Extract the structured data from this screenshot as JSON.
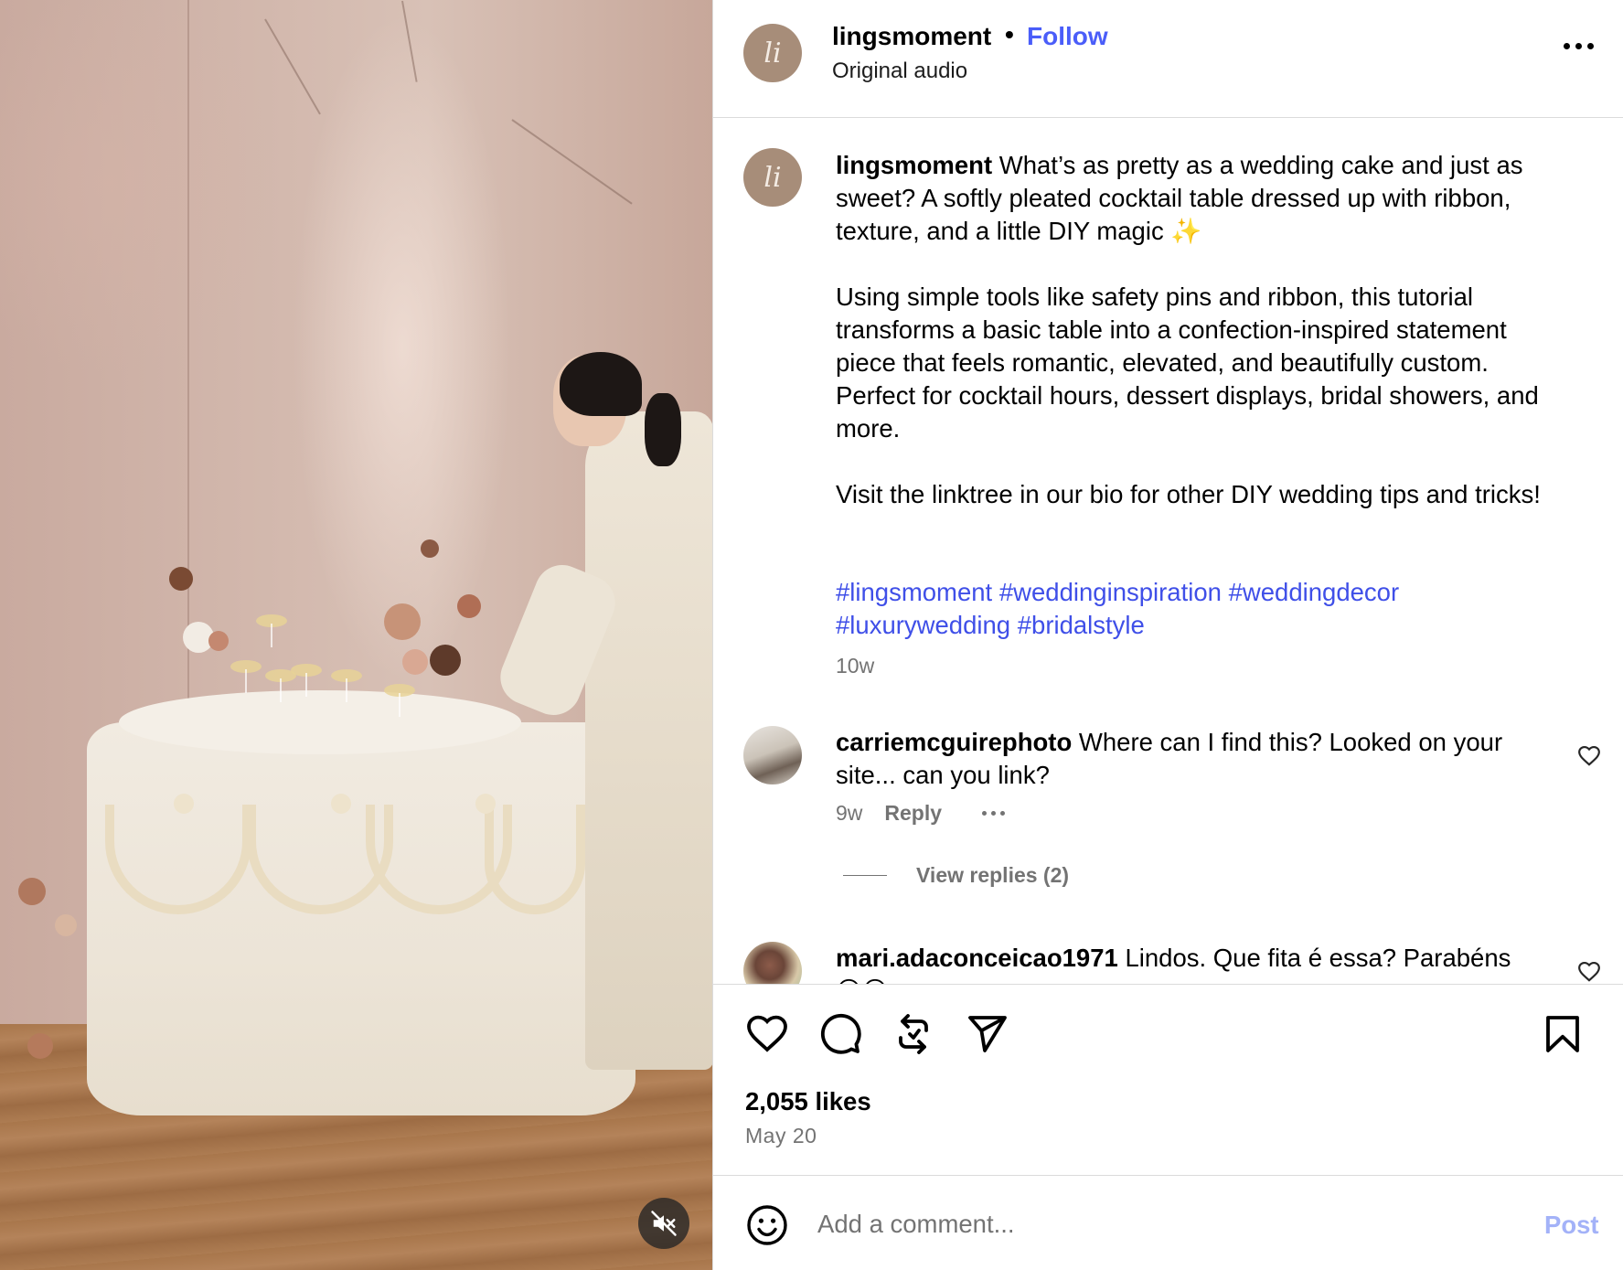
{
  "post": {
    "username": "lingsmoment",
    "separator": "•",
    "follow_label": "Follow",
    "audio": "Original audio",
    "avatar_initials": "li",
    "caption_paragraphs": [
      "What’s as pretty as a wedding cake and just as sweet? A softly pleated cocktail table dressed up with ribbon, texture, and a little DIY magic ✨",
      "Using simple tools like safety pins and ribbon, this tutorial transforms a basic table into a confection-inspired statement piece that feels romantic, elevated, and beautifully custom. Perfect for cocktail hours, dessert displays, bridal showers, and more.",
      "Visit the linktree in our bio for other DIY wedding tips and tricks!"
    ],
    "hashtags": [
      "#lingsmoment",
      "#weddinginspiration",
      "#weddingdecor",
      "#luxurywedding",
      "#bridalstyle"
    ],
    "caption_time": "10w",
    "likes": "2,055 likes",
    "date": "May 20"
  },
  "comments": [
    {
      "username": "carriemcguirephoto",
      "text": "Where can I find this? Looked on your site... can you link?",
      "time": "9w",
      "reply_label": "Reply",
      "view_replies": "View replies (2)"
    },
    {
      "username": "mari.adaconceicao1971",
      "text": "Lindos. Que fita é essa? Parabéns 😊😊"
    }
  ],
  "composer": {
    "placeholder": "Add a comment...",
    "post_label": "Post"
  },
  "icons": {
    "more": "more-options-icon",
    "like": "heart-icon",
    "comment": "comment-icon",
    "repost": "repost-icon",
    "share": "share-icon",
    "save": "bookmark-icon",
    "emoji": "emoji-icon",
    "mute": "muted-speaker-icon"
  },
  "colors": {
    "link_blue": "#4a5df9",
    "hashtag_blue": "#3f4fe8",
    "secondary_text": "#737373",
    "post_disabled": "#a3b2f8",
    "divider": "#dbdbdb"
  }
}
